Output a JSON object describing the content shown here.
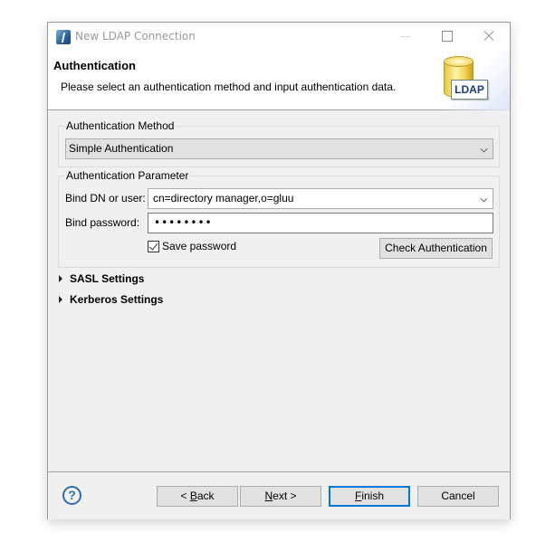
{
  "window": {
    "title": "New LDAP Connection",
    "icon": "eclipse-app-icon",
    "controls": [
      "minimize-icon",
      "maximize-icon",
      "close-icon"
    ]
  },
  "banner": {
    "title": "Authentication",
    "description": "Please select an authentication method and input authentication data.",
    "icon_label": "LDAP"
  },
  "auth_method": {
    "legend": "Authentication Method",
    "selected": "Simple Authentication"
  },
  "auth_param": {
    "legend": "Authentication Parameter",
    "bind_dn_label": "Bind DN or user:",
    "bind_dn_value": "cn=directory manager,o=gluu",
    "bind_password_label": "Bind password:",
    "bind_password_value": "••••••••",
    "save_password_label": "Save password",
    "save_password_checked": true,
    "check_button": "Check Authentication"
  },
  "sections": [
    {
      "label": "SASL Settings",
      "expanded": false
    },
    {
      "label": "Kerberos Settings",
      "expanded": false
    }
  ],
  "footer": {
    "help_icon": "help-icon",
    "back_prefix": "< ",
    "back_mnemonic": "B",
    "back_rest": "ack",
    "next_mnemonic": "N",
    "next_rest": "ext >",
    "finish_mnemonic": "F",
    "finish_rest": "inish",
    "cancel": "Cancel"
  },
  "colors": {
    "accent": "#0078d7",
    "help": "#2d6db0",
    "ldap_text": "#1b3f7a"
  }
}
